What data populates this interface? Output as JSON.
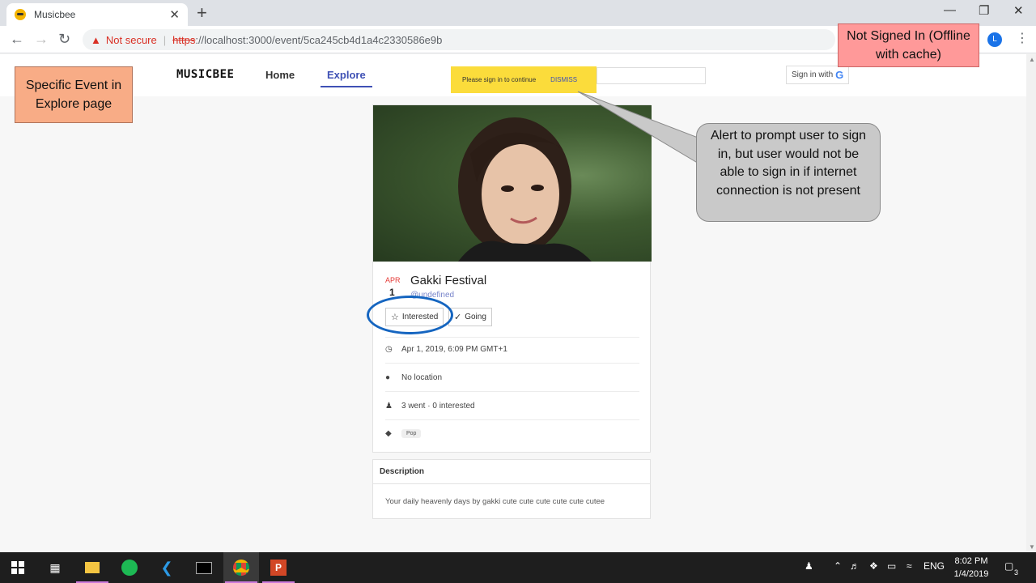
{
  "browser": {
    "tab_title": "Musicbee",
    "tab_close": "✕",
    "new_tab": "+",
    "not_secure": "Not secure",
    "url_scheme": "https",
    "url_rest": "://localhost:3000/event/5ca245cb4d1a4c2330586e9b",
    "profile_initial": "L"
  },
  "app": {
    "brand": "MUSICBEE",
    "nav": {
      "home": "Home",
      "explore": "Explore"
    },
    "sign_in_label": "Sign in with",
    "google_glyph": "G"
  },
  "snackbar": {
    "message": "Please sign in to continue",
    "action": "DISMISS"
  },
  "event": {
    "month": "APR",
    "day": "1",
    "title": "Gakki Festival",
    "host": "@undefined",
    "interested_label": "Interested",
    "going_label": "Going",
    "datetime": "Apr 1, 2019, 6:09 PM GMT+1",
    "location": "No location",
    "attendance": "3 went · 0 interested",
    "tag": "Pop"
  },
  "description": {
    "heading": "Description",
    "body": "Your daily heavenly days by gakki cute cute cute cute cute cutee"
  },
  "annotations": {
    "event_note": "Specific Event in Explore page",
    "signed_note": "Not Signed In (Offline with cache)",
    "alert_note": "Alert to prompt user to sign in, but user would not be able to sign in if internet connection is not present"
  },
  "taskbar": {
    "lang": "ENG",
    "time": "8:02 PM",
    "date": "1/4/2019",
    "notification_count": "3"
  },
  "colors": {
    "accent": "#3f51b5",
    "snackbar": "#fbdc3b",
    "error": "#d93025",
    "ring": "#1565c0"
  }
}
